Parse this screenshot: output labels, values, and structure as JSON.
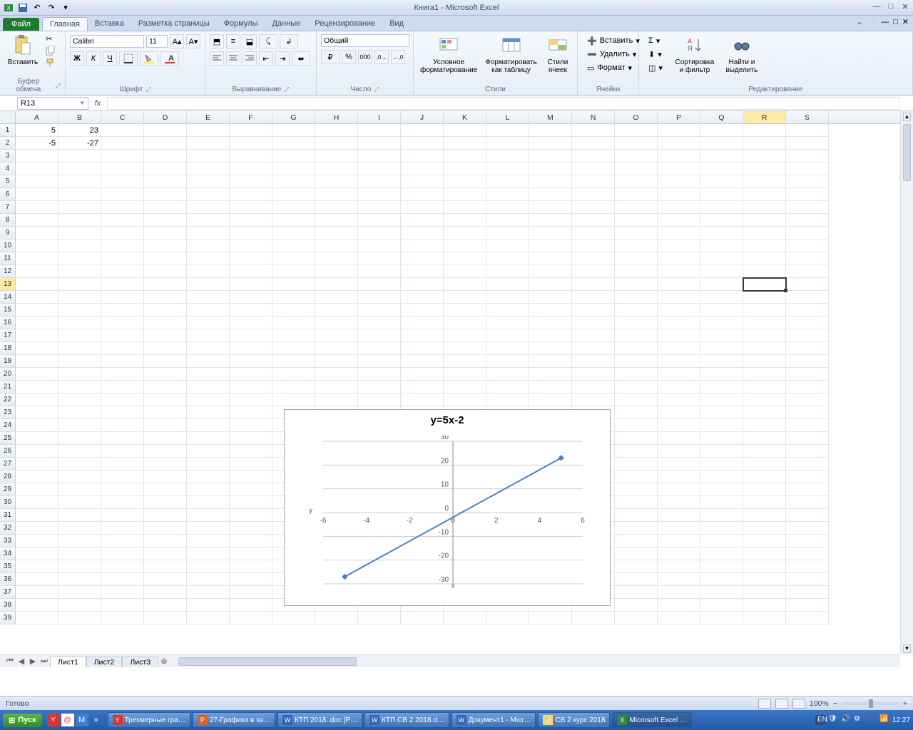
{
  "window_title": "Книга1 - Microsoft Excel",
  "file_tab": "Файл",
  "tabs": [
    "Главная",
    "Вставка",
    "Разметка страницы",
    "Формулы",
    "Данные",
    "Рецензирование",
    "Вид"
  ],
  "active_tab_index": 0,
  "ribbon": {
    "clipboard": {
      "label": "Буфер обмена",
      "paste": "Вставить"
    },
    "font": {
      "label": "Шрифт",
      "name": "Calibri",
      "size": "11"
    },
    "align": {
      "label": "Выравнивание"
    },
    "number": {
      "label": "Число",
      "format": "Общий"
    },
    "styles": {
      "label": "Стили",
      "cond": "Условное\nформатирование",
      "table": "Форматировать\nкак таблицу",
      "cell": "Стили\nячеек"
    },
    "cells": {
      "label": "Ячейки",
      "insert": "Вставить",
      "delete": "Удалить",
      "format": "Формат"
    },
    "editing": {
      "label": "Редактирование",
      "sort": "Сортировка\nи фильтр",
      "find": "Найти и\nвыделить"
    }
  },
  "name_box": "R13",
  "formula": "",
  "columns": [
    "A",
    "B",
    "C",
    "D",
    "E",
    "F",
    "G",
    "H",
    "I",
    "J",
    "K",
    "L",
    "M",
    "N",
    "O",
    "P",
    "Q",
    "R",
    "S"
  ],
  "selected_column": "R",
  "selected_row": 13,
  "row_count": 39,
  "cell_data": {
    "1": {
      "A": "5",
      "B": "23"
    },
    "2": {
      "A": "-5",
      "B": "-27"
    }
  },
  "sheets": [
    "Лист1",
    "Лист2",
    "Лист3"
  ],
  "active_sheet": 0,
  "status": "Готово",
  "zoom": "100%",
  "chart_data": {
    "type": "line",
    "title": "y=5x-2",
    "xlabel": "x",
    "ylabel": "y",
    "xlim": [
      -6,
      6
    ],
    "ylim": [
      -30,
      30
    ],
    "x_ticks": [
      -6,
      -4,
      -2,
      0,
      2,
      4,
      6
    ],
    "y_ticks": [
      -30,
      -20,
      -10,
      0,
      10,
      20,
      30
    ],
    "series": [
      {
        "name": "y",
        "x": [
          -5,
          5
        ],
        "y": [
          -27,
          23
        ]
      }
    ]
  },
  "taskbar": {
    "start": "Пуск",
    "items": [
      "Трехмерные гра…",
      "27-Графика в яз…",
      "КТП 2018..doc [Р…",
      "КТП СВ 2 2018.d…",
      "Документ1 - Micr…",
      "СВ 2 курс 2018",
      "Microsoft Excel …"
    ],
    "active_item": 6,
    "lang": "EN",
    "time": "12:27"
  }
}
